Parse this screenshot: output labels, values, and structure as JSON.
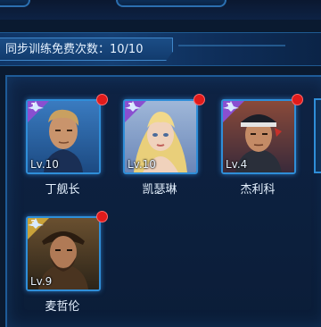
{
  "header": {
    "free_training_label": "同步训练免费次数：10/10"
  },
  "officers": [
    {
      "name": "丁舰长",
      "level": "Lv.10",
      "rank": "1",
      "rank_color": "#8a4fd0",
      "has_notification": true
    },
    {
      "name": "凯瑟琳",
      "level": "Lv.10",
      "rank": "1",
      "rank_color": "#8a4fd0",
      "has_notification": true
    },
    {
      "name": "杰利科",
      "level": "Lv.4",
      "rank": "1",
      "rank_color": "#8a4fd0",
      "has_notification": true
    },
    {
      "name": "麦哲伦",
      "level": "Lv.9",
      "rank": "3",
      "rank_color": "#c9a23a",
      "has_notification": true
    }
  ],
  "colors": {
    "accent": "#2f8ed8",
    "notification": "#e11b1b",
    "panel": "#0b1d38"
  }
}
